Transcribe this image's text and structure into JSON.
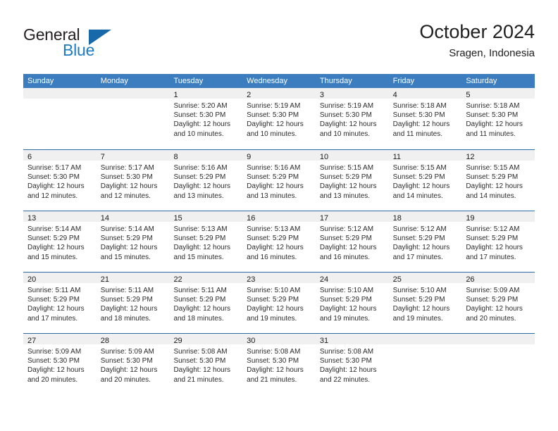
{
  "brand": {
    "name_top": "General",
    "name_bottom": "Blue",
    "triangle_color": "#1769aa",
    "blue_color": "#1f7bc1"
  },
  "header": {
    "title": "October 2024",
    "subtitle": "Sragen, Indonesia"
  },
  "theme": {
    "header_blue": "#3b7dbf",
    "row_rule_blue": "#2e6da4",
    "day_strip_gray": "#f0f0f0"
  },
  "weekdays": [
    "Sunday",
    "Monday",
    "Tuesday",
    "Wednesday",
    "Thursday",
    "Friday",
    "Saturday"
  ],
  "weeks": [
    [
      {
        "empty": true
      },
      {
        "empty": true
      },
      {
        "day": "1",
        "l1": "Sunrise: 5:20 AM",
        "l2": "Sunset: 5:30 PM",
        "l3": "Daylight: 12 hours",
        "l4": "and 10 minutes."
      },
      {
        "day": "2",
        "l1": "Sunrise: 5:19 AM",
        "l2": "Sunset: 5:30 PM",
        "l3": "Daylight: 12 hours",
        "l4": "and 10 minutes."
      },
      {
        "day": "3",
        "l1": "Sunrise: 5:19 AM",
        "l2": "Sunset: 5:30 PM",
        "l3": "Daylight: 12 hours",
        "l4": "and 10 minutes."
      },
      {
        "day": "4",
        "l1": "Sunrise: 5:18 AM",
        "l2": "Sunset: 5:30 PM",
        "l3": "Daylight: 12 hours",
        "l4": "and 11 minutes."
      },
      {
        "day": "5",
        "l1": "Sunrise: 5:18 AM",
        "l2": "Sunset: 5:30 PM",
        "l3": "Daylight: 12 hours",
        "l4": "and 11 minutes."
      }
    ],
    [
      {
        "day": "6",
        "l1": "Sunrise: 5:17 AM",
        "l2": "Sunset: 5:30 PM",
        "l3": "Daylight: 12 hours",
        "l4": "and 12 minutes."
      },
      {
        "day": "7",
        "l1": "Sunrise: 5:17 AM",
        "l2": "Sunset: 5:30 PM",
        "l3": "Daylight: 12 hours",
        "l4": "and 12 minutes."
      },
      {
        "day": "8",
        "l1": "Sunrise: 5:16 AM",
        "l2": "Sunset: 5:29 PM",
        "l3": "Daylight: 12 hours",
        "l4": "and 13 minutes."
      },
      {
        "day": "9",
        "l1": "Sunrise: 5:16 AM",
        "l2": "Sunset: 5:29 PM",
        "l3": "Daylight: 12 hours",
        "l4": "and 13 minutes."
      },
      {
        "day": "10",
        "l1": "Sunrise: 5:15 AM",
        "l2": "Sunset: 5:29 PM",
        "l3": "Daylight: 12 hours",
        "l4": "and 13 minutes."
      },
      {
        "day": "11",
        "l1": "Sunrise: 5:15 AM",
        "l2": "Sunset: 5:29 PM",
        "l3": "Daylight: 12 hours",
        "l4": "and 14 minutes."
      },
      {
        "day": "12",
        "l1": "Sunrise: 5:15 AM",
        "l2": "Sunset: 5:29 PM",
        "l3": "Daylight: 12 hours",
        "l4": "and 14 minutes."
      }
    ],
    [
      {
        "day": "13",
        "l1": "Sunrise: 5:14 AM",
        "l2": "Sunset: 5:29 PM",
        "l3": "Daylight: 12 hours",
        "l4": "and 15 minutes."
      },
      {
        "day": "14",
        "l1": "Sunrise: 5:14 AM",
        "l2": "Sunset: 5:29 PM",
        "l3": "Daylight: 12 hours",
        "l4": "and 15 minutes."
      },
      {
        "day": "15",
        "l1": "Sunrise: 5:13 AM",
        "l2": "Sunset: 5:29 PM",
        "l3": "Daylight: 12 hours",
        "l4": "and 15 minutes."
      },
      {
        "day": "16",
        "l1": "Sunrise: 5:13 AM",
        "l2": "Sunset: 5:29 PM",
        "l3": "Daylight: 12 hours",
        "l4": "and 16 minutes."
      },
      {
        "day": "17",
        "l1": "Sunrise: 5:12 AM",
        "l2": "Sunset: 5:29 PM",
        "l3": "Daylight: 12 hours",
        "l4": "and 16 minutes."
      },
      {
        "day": "18",
        "l1": "Sunrise: 5:12 AM",
        "l2": "Sunset: 5:29 PM",
        "l3": "Daylight: 12 hours",
        "l4": "and 17 minutes."
      },
      {
        "day": "19",
        "l1": "Sunrise: 5:12 AM",
        "l2": "Sunset: 5:29 PM",
        "l3": "Daylight: 12 hours",
        "l4": "and 17 minutes."
      }
    ],
    [
      {
        "day": "20",
        "l1": "Sunrise: 5:11 AM",
        "l2": "Sunset: 5:29 PM",
        "l3": "Daylight: 12 hours",
        "l4": "and 17 minutes."
      },
      {
        "day": "21",
        "l1": "Sunrise: 5:11 AM",
        "l2": "Sunset: 5:29 PM",
        "l3": "Daylight: 12 hours",
        "l4": "and 18 minutes."
      },
      {
        "day": "22",
        "l1": "Sunrise: 5:11 AM",
        "l2": "Sunset: 5:29 PM",
        "l3": "Daylight: 12 hours",
        "l4": "and 18 minutes."
      },
      {
        "day": "23",
        "l1": "Sunrise: 5:10 AM",
        "l2": "Sunset: 5:29 PM",
        "l3": "Daylight: 12 hours",
        "l4": "and 19 minutes."
      },
      {
        "day": "24",
        "l1": "Sunrise: 5:10 AM",
        "l2": "Sunset: 5:29 PM",
        "l3": "Daylight: 12 hours",
        "l4": "and 19 minutes."
      },
      {
        "day": "25",
        "l1": "Sunrise: 5:10 AM",
        "l2": "Sunset: 5:29 PM",
        "l3": "Daylight: 12 hours",
        "l4": "and 19 minutes."
      },
      {
        "day": "26",
        "l1": "Sunrise: 5:09 AM",
        "l2": "Sunset: 5:29 PM",
        "l3": "Daylight: 12 hours",
        "l4": "and 20 minutes."
      }
    ],
    [
      {
        "day": "27",
        "l1": "Sunrise: 5:09 AM",
        "l2": "Sunset: 5:30 PM",
        "l3": "Daylight: 12 hours",
        "l4": "and 20 minutes."
      },
      {
        "day": "28",
        "l1": "Sunrise: 5:09 AM",
        "l2": "Sunset: 5:30 PM",
        "l3": "Daylight: 12 hours",
        "l4": "and 20 minutes."
      },
      {
        "day": "29",
        "l1": "Sunrise: 5:08 AM",
        "l2": "Sunset: 5:30 PM",
        "l3": "Daylight: 12 hours",
        "l4": "and 21 minutes."
      },
      {
        "day": "30",
        "l1": "Sunrise: 5:08 AM",
        "l2": "Sunset: 5:30 PM",
        "l3": "Daylight: 12 hours",
        "l4": "and 21 minutes."
      },
      {
        "day": "31",
        "l1": "Sunrise: 5:08 AM",
        "l2": "Sunset: 5:30 PM",
        "l3": "Daylight: 12 hours",
        "l4": "and 22 minutes."
      },
      {
        "empty": true
      },
      {
        "empty": true
      }
    ]
  ]
}
